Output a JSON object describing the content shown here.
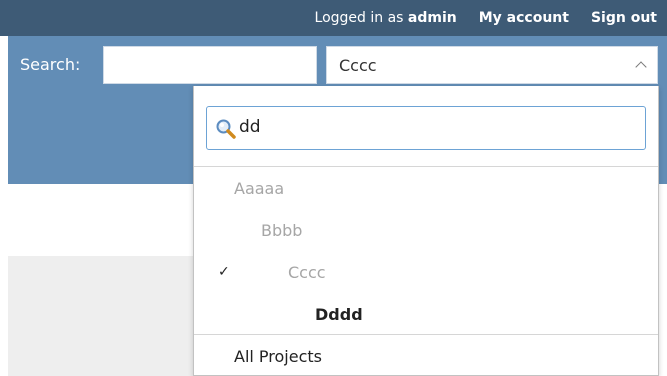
{
  "topbar": {
    "logged_in_prefix": "Logged in as",
    "username": "admin",
    "my_account": "My account",
    "sign_out": "Sign out"
  },
  "search": {
    "label": "Search:",
    "value": ""
  },
  "project_selector": {
    "selected": "Cccc",
    "filter_value": "dd",
    "options": [
      {
        "label": "Aaaaa",
        "state": "disabled",
        "indent_level": 0,
        "selected": false
      },
      {
        "label": "Bbbb",
        "state": "disabled",
        "indent_level": 1,
        "selected": false
      },
      {
        "label": "Cccc",
        "state": "disabled",
        "indent_level": 2,
        "selected": true,
        "check": "✓"
      },
      {
        "label": "Dddd",
        "state": "match",
        "indent_level": 3,
        "selected": false
      }
    ],
    "all_projects": "All Projects"
  },
  "colors": {
    "topbar_bg": "#3e5b76",
    "header_bg": "#628db6",
    "focus_border": "#6da3d5",
    "disabled_text": "#a6a6a6"
  },
  "icons": {
    "search_field": "magnifier-icon",
    "selected_mark": "checkmark-icon",
    "select_toggle": "chevron-up-icon"
  }
}
